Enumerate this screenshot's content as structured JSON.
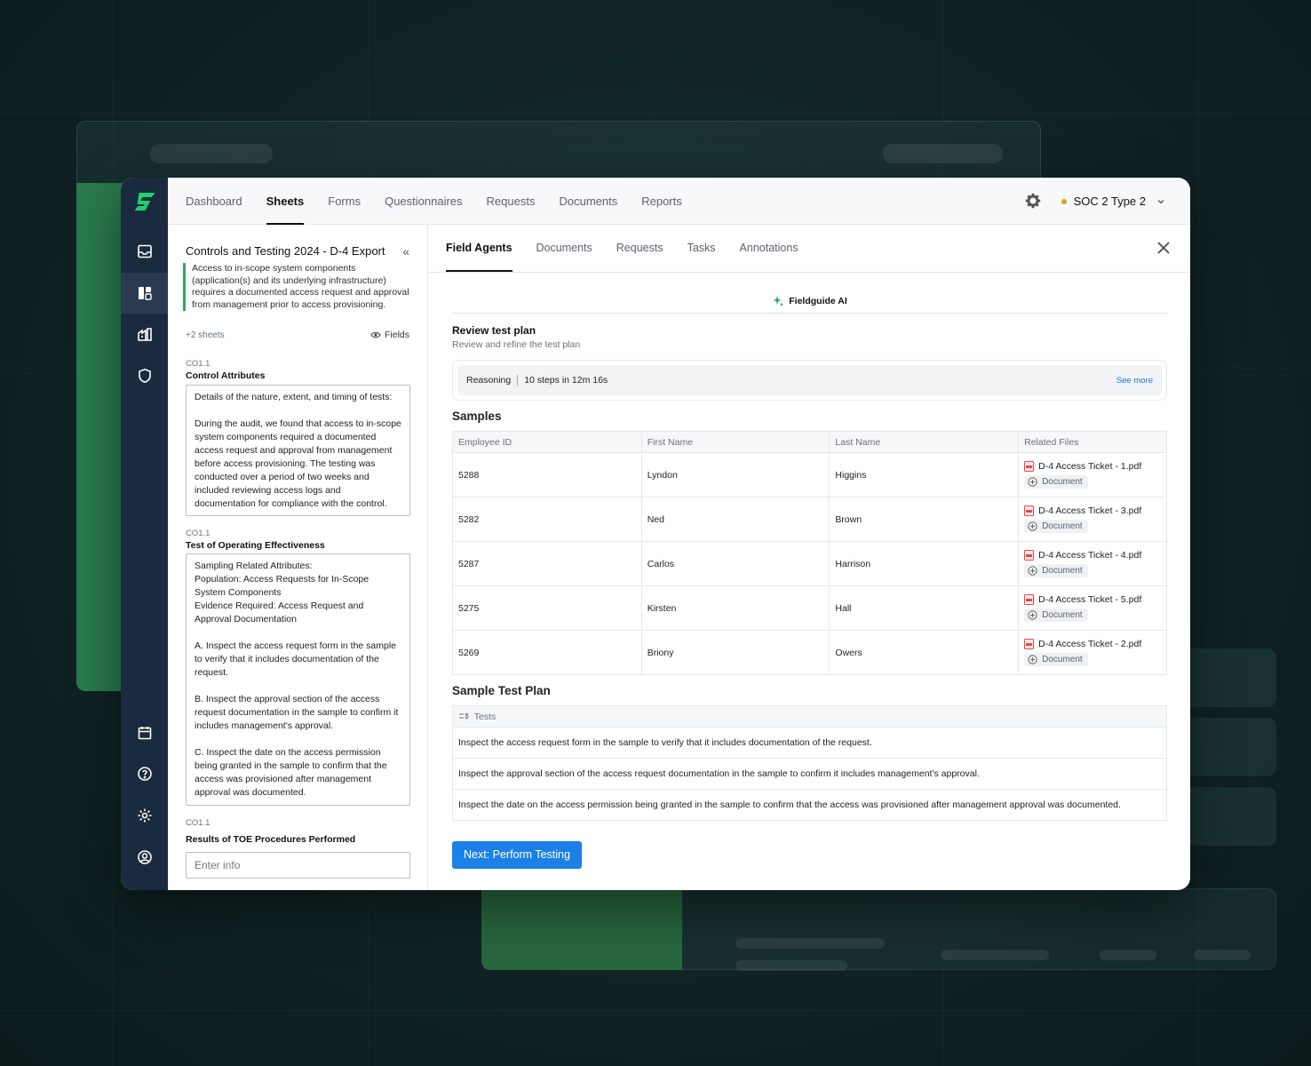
{
  "nav": {
    "items": [
      "Dashboard",
      "Sheets",
      "Forms",
      "Questionnaires",
      "Requests",
      "Documents",
      "Reports"
    ],
    "active": "Sheets",
    "environment": "SOC 2 Type 2",
    "env_dot_color": "#e0a500"
  },
  "rail": {
    "icons": [
      "inbox-icon",
      "layout-icon",
      "factory-icon",
      "shield-icon",
      "calendar-icon",
      "help-icon",
      "gear-icon",
      "user-circle-icon"
    ],
    "active": "layout-icon",
    "brand_color": "#1fd16b"
  },
  "left": {
    "title": "Controls and Testing 2024 - D-4 Export",
    "quote": "Access to in-scope system components (application(s) and its underlying infrastructure) requires a documented access request and approval from management prior to access provisioning.",
    "sheets_count": "+2 sheets",
    "fields_label": "Fields",
    "sections": [
      {
        "code": "CO1.1",
        "label": "Control Attributes",
        "body": "Details of the nature, extent, and timing of tests:\n\nDuring the audit, we found that access to in-scope system components required a documented access request and approval from management before access provisioning. The testing was conducted over a period of two weeks and included reviewing access logs and documentation for compliance with the control."
      },
      {
        "code": "CO1.1",
        "label": "Test of Operating Effectiveness",
        "body": "Sampling Related Attributes:\nPopulation: Access Requests for In-Scope System Components\nEvidence Required: Access Request and Approval Documentation\n\nA. Inspect the access request form in the sample to verify that it includes documentation of the request.\n\nB. Inspect the approval section of the access request documentation in the sample to confirm it includes management's approval.\n\nC. Inspect the date on the access permission being granted in the sample to confirm that the access was provisioned after management approval was documented."
      },
      {
        "code": "CO1.1",
        "label": "Results of TOE Procedures Performed",
        "placeholder": "Enter info"
      }
    ]
  },
  "right": {
    "tabs": [
      "Field Agents",
      "Documents",
      "Requests",
      "Tasks",
      "Annotations"
    ],
    "active_tab": "Field Agents",
    "ai_label": "Fieldguide AI",
    "review_title": "Review test plan",
    "review_sub": "Review and refine the test plan",
    "reasoning_label": "Reasoning",
    "reasoning_steps": "10 steps in 12m 16s",
    "see_more": "See more",
    "samples_title": "Samples",
    "columns": [
      "Employee ID",
      "First Name",
      "Last Name",
      "Related Files"
    ],
    "rows": [
      {
        "id": "5288",
        "first": "Lyndon",
        "last": "Higgins",
        "file": "D-4 Access Ticket - 1.pdf",
        "chip": "Document"
      },
      {
        "id": "5282",
        "first": "Ned",
        "last": "Brown",
        "file": "D-4 Access Ticket - 3.pdf",
        "chip": "Document"
      },
      {
        "id": "5287",
        "first": "Carlos",
        "last": "Harrison",
        "file": "D-4 Access Ticket - 4.pdf",
        "chip": "Document"
      },
      {
        "id": "5275",
        "first": "Kirsten",
        "last": "Hall",
        "file": "D-4 Access Ticket - 5.pdf",
        "chip": "Document"
      },
      {
        "id": "5269",
        "first": "Briony",
        "last": "Owers",
        "file": "D-4 Access Ticket - 2.pdf",
        "chip": "Document"
      }
    ],
    "plan_title": "Sample Test Plan",
    "tests_header": "Tests",
    "tests": [
      "Inspect the access request form in the sample to verify that it includes documentation of the request.",
      "Inspect the approval section of the access request documentation in the sample to confirm it includes management's approval.",
      "Inspect the date on the access permission being granted in the sample to confirm that the access was provisioned after management approval was documented."
    ],
    "next_button": "Next: Perform Testing",
    "accent": "#1d80e6"
  }
}
